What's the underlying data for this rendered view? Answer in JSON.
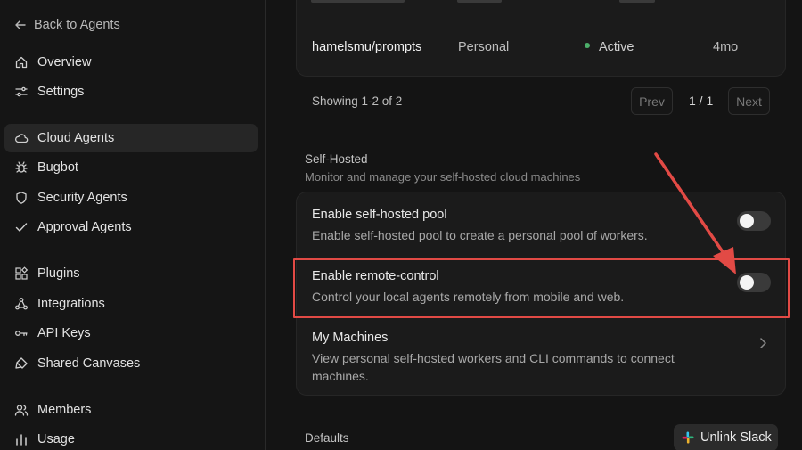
{
  "sidebar": {
    "back_label": "Back to Agents",
    "items": [
      {
        "label": "Overview",
        "icon": "home-icon"
      },
      {
        "label": "Settings",
        "icon": "sliders-icon"
      },
      {
        "label": "Cloud Agents",
        "icon": "cloud-icon",
        "active": true
      },
      {
        "label": "Bugbot",
        "icon": "bug-icon"
      },
      {
        "label": "Security Agents",
        "icon": "shield-icon"
      },
      {
        "label": "Approval Agents",
        "icon": "check-icon"
      },
      {
        "label": "Plugins",
        "icon": "puzzle-icon"
      },
      {
        "label": "Integrations",
        "icon": "integrations-icon"
      },
      {
        "label": "API Keys",
        "icon": "key-icon"
      },
      {
        "label": "Shared Canvases",
        "icon": "brush-icon"
      },
      {
        "label": "Members",
        "icon": "users-icon"
      },
      {
        "label": "Usage",
        "icon": "bar-chart-icon"
      }
    ]
  },
  "repos": {
    "rows": [
      {
        "name": "hamelsmu/prompts",
        "type": "Personal",
        "status": "Active",
        "age": "4mo"
      }
    ],
    "showing": "Showing 1-2 of 2",
    "prev_label": "Prev",
    "page": "1 / 1",
    "next_label": "Next"
  },
  "self_hosted": {
    "title": "Self-Hosted",
    "subtitle": "Monitor and manage your self-hosted cloud machines",
    "pool": {
      "title": "Enable self-hosted pool",
      "desc": "Enable self-hosted pool to create a personal pool of workers.",
      "enabled": false
    },
    "remote": {
      "title": "Enable remote-control",
      "desc": "Control your local agents remotely from mobile and web.",
      "enabled": false
    },
    "machines": {
      "title": "My Machines",
      "desc": "View personal self-hosted workers and CLI commands to connect machines."
    }
  },
  "defaults": {
    "title": "Defaults",
    "slack_label": "Unlink Slack"
  },
  "colors": {
    "accent_red": "#e24a45",
    "status_green": "#4caf6a"
  }
}
